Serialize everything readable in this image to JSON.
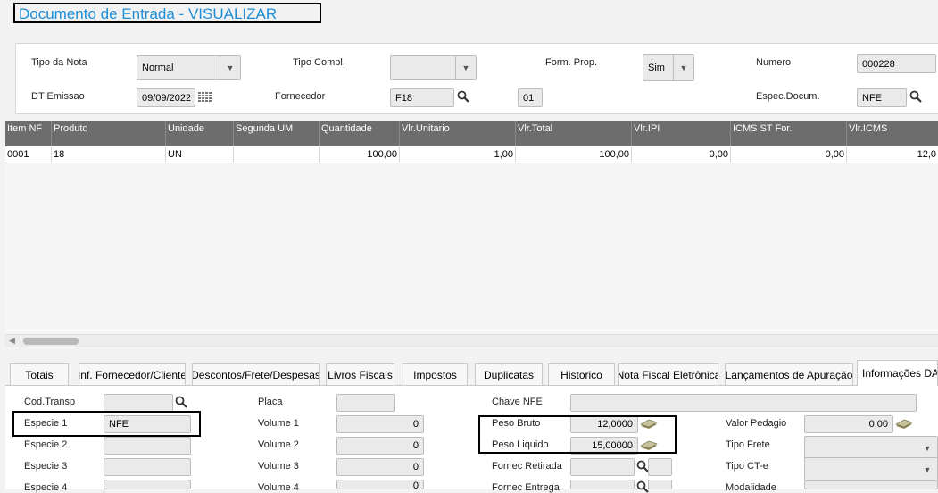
{
  "title": "Documento de Entrada - VISUALIZAR",
  "header": {
    "tipo_nota_label": "Tipo da Nota",
    "tipo_nota_value": "Normal",
    "tipo_compl_label": "Tipo Compl.",
    "tipo_compl_value": "",
    "form_prop_label": "Form. Prop.",
    "form_prop_value": "Sim",
    "numero_label": "Numero",
    "numero_value": "000228",
    "dt_emissao_label": "DT Emissao",
    "dt_emissao_value": "09/09/2022",
    "fornecedor_label": "Fornecedor",
    "fornecedor_value": "F18",
    "loja_value": "01",
    "espec_documento_label": "Espec.Docum.",
    "espec_documento_value": "NFE"
  },
  "grid": {
    "columns": [
      "Item NF",
      "Produto",
      "Unidade",
      "Segunda UM",
      "Quantidade",
      "Vlr.Unitario",
      "Vlr.Total",
      "Vlr.IPI",
      "ICMS ST For.",
      "Vlr.ICMS"
    ],
    "rows": [
      [
        "0001",
        "18",
        "UN",
        "",
        "100,00",
        "1,00",
        "100,00",
        "0,00",
        "0,00",
        "12,0"
      ]
    ]
  },
  "tabs": [
    "Totais",
    "Inf. Fornecedor/Cliente",
    "Descontos/Frete/Despesas",
    "Livros Fiscais",
    "Impostos",
    "Duplicatas",
    "Historico",
    "Nota Fiscal Eletrônica",
    "Lançamentos de Apuração",
    "Informações DAN"
  ],
  "active_tab": "Informações DAN",
  "danfe": {
    "cod_transp_label": "Cod.Transp",
    "cod_transp_value": "",
    "especie1_label": "Especie 1",
    "especie1_value": "NFE",
    "especie2_label": "Especie 2",
    "especie2_value": "",
    "especie3_label": "Especie 3",
    "especie3_value": "",
    "especie4_label": "Especie 4",
    "especie4_value": "",
    "placa_label": "Placa",
    "placa_value": "",
    "volume1_label": "Volume 1",
    "volume1_value": "0",
    "volume2_label": "Volume 2",
    "volume2_value": "0",
    "volume3_label": "Volume 3",
    "volume3_value": "0",
    "volume4_label": "Volume 4",
    "volume4_value": "0",
    "chave_nfe_label": "Chave NFE",
    "chave_nfe_value": "",
    "peso_bruto_label": "Peso Bruto",
    "peso_bruto_value": "12,0000",
    "peso_liquido_label": "Peso Liquido",
    "peso_liquido_value": "15,00000",
    "fornec_retirada_label": "Fornec Retirada",
    "fornec_entrega_label": "Fornec Entrega",
    "valor_pedagio_label": "Valor Pedagio",
    "valor_pedagio_value": "0,00",
    "tipo_frete_label": "Tipo Frete",
    "tipo_cte_label": "Tipo CT-e",
    "modalidade_label": "Modalidade"
  },
  "colors": {
    "title": "#1d8dd6",
    "grid_header": "#6d6d6d"
  }
}
